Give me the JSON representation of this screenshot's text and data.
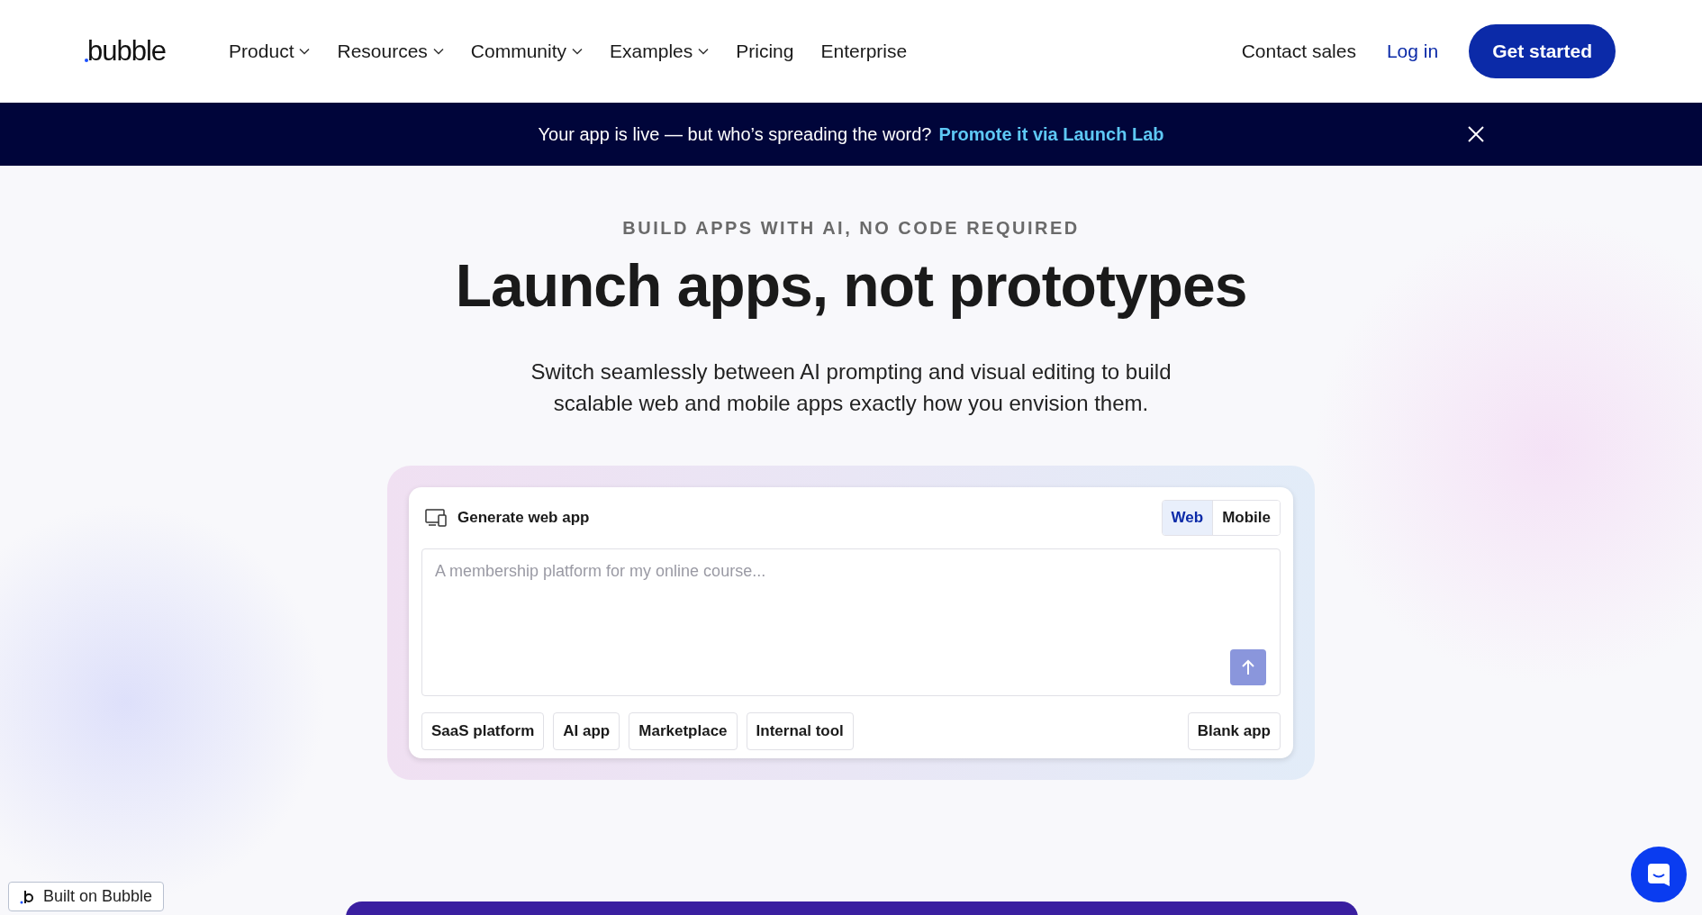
{
  "header": {
    "logo": "bubble",
    "menu": [
      {
        "label": "Product",
        "has_dropdown": true
      },
      {
        "label": "Resources",
        "has_dropdown": true
      },
      {
        "label": "Community",
        "has_dropdown": true
      },
      {
        "label": "Examples",
        "has_dropdown": true
      },
      {
        "label": "Pricing",
        "has_dropdown": false
      },
      {
        "label": "Enterprise",
        "has_dropdown": false
      }
    ],
    "contact": "Contact sales",
    "login": "Log in",
    "cta": "Get started"
  },
  "banner": {
    "text": "Your app is live — but who’s spreading the word?",
    "link": "Promote it via Launch Lab"
  },
  "hero": {
    "eyebrow": "BUILD APPS WITH AI, NO CODE REQUIRED",
    "title": "Launch apps, not prototypes",
    "subtitle": "Switch seamlessly between AI prompting and visual editing to build scalable web and mobile apps exactly how you envision them."
  },
  "generator": {
    "title": "Generate web app",
    "modes": [
      {
        "label": "Web",
        "selected": true
      },
      {
        "label": "Mobile",
        "selected": false
      }
    ],
    "prompt": {
      "placeholder": "A membership platform for my online course..."
    },
    "suggestions": [
      "SaaS platform",
      "AI app",
      "Marketplace",
      "Internal tool"
    ],
    "blank": "Blank app"
  },
  "badge": {
    "text": "Built on Bubble"
  }
}
